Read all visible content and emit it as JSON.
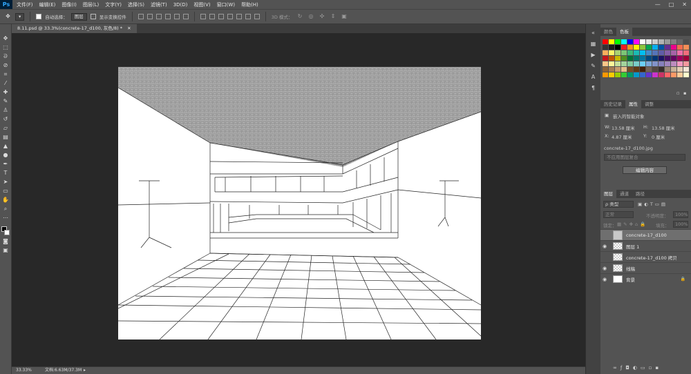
{
  "app": {
    "logo": "Ps",
    "menu": [
      "文件(F)",
      "编辑(E)",
      "图像(I)",
      "图层(L)",
      "文字(Y)",
      "选择(S)",
      "滤镜(T)",
      "3D(D)",
      "视图(V)",
      "窗口(W)",
      "帮助(H)"
    ],
    "window_controls": [
      "—",
      "□",
      "✕"
    ]
  },
  "options_bar": {
    "auto_select_label": "自动选择：",
    "auto_select_target": "图层",
    "show_transform_label": "显示变换控件",
    "mode_3d_label": "3D 模式："
  },
  "document": {
    "tab_title": "8.11.psd @ 33.3%(concrete-17_d100, 灰色/8) *"
  },
  "status_bar": {
    "zoom": "33.33%",
    "doc_info": "文档:6.63M/37.3M"
  },
  "panels": {
    "color_tabs": [
      "颜色",
      "色板"
    ],
    "mid_tabs": [
      "历史记录",
      "属性",
      "调整"
    ],
    "properties": {
      "title": "嵌入的智能对象",
      "w_label": "W:",
      "w_value": "13.58 厘米",
      "h_label": "H:",
      "h_value": "13.58 厘米",
      "x_label": "X:",
      "x_value": "4.87 厘米",
      "y_label": "Y:",
      "y_value": "0 厘米",
      "source_file": "concrete-17_d100.jpg",
      "comp_placeholder": "不应用图层复合",
      "edit_button": "编辑内容"
    },
    "layers_tabs": [
      "图层",
      "通道",
      "路径"
    ],
    "layers_filter": "ρ 类型",
    "blend_mode": "正常",
    "opacity_label": "不透明度：",
    "opacity_value": "100%",
    "lock_label": "锁定：",
    "fill_label": "填充：",
    "fill_value": "100%",
    "layers": [
      {
        "name": "concrete-17_d100",
        "visible": false,
        "selected": true,
        "thumb": "smart"
      },
      {
        "name": "图层 1",
        "visible": true,
        "selected": false,
        "thumb": "checker"
      },
      {
        "name": "concrete-17_d100 拷贝",
        "visible": false,
        "selected": false,
        "thumb": "checker"
      },
      {
        "name": "线稿",
        "visible": true,
        "selected": false,
        "thumb": "checker"
      },
      {
        "name": "背景",
        "visible": true,
        "selected": false,
        "thumb": "white",
        "locked": true
      }
    ]
  },
  "colors": {
    "chrome": "#535353",
    "workspace": "#282828",
    "accent_blue": "#31a8ff"
  }
}
